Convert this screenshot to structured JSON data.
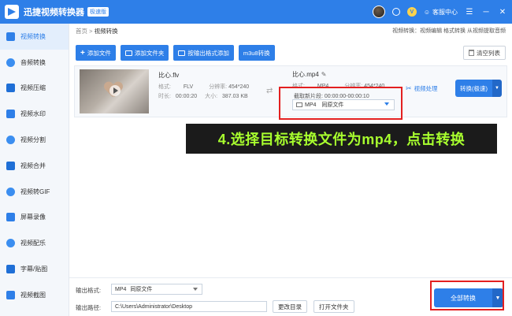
{
  "app": {
    "title": "迅捷视频转换器",
    "edition": "极速版",
    "service": "客服中心",
    "vip": "V"
  },
  "sidebar": {
    "items": [
      {
        "label": "视频转换",
        "active": true
      },
      {
        "label": "音频转换"
      },
      {
        "label": "视频压缩"
      },
      {
        "label": "视频水印"
      },
      {
        "label": "视频分割"
      },
      {
        "label": "视频合并"
      },
      {
        "label": "视频转GIF"
      },
      {
        "label": "屏幕录像"
      },
      {
        "label": "视频配乐"
      },
      {
        "label": "字幕/贴图"
      },
      {
        "label": "视频截图"
      }
    ]
  },
  "breadcrumb": {
    "home": "首页",
    "sep": ">",
    "current": "视频转换"
  },
  "top_links": "视频转换：视频编辑 格式转换 从视频提取音频",
  "toolbar": {
    "add_file": "添加文件",
    "add_folder": "添加文件夹",
    "add_by_format": "按输出格式添加",
    "m3u8": "m3u8转换",
    "clear": "清空列表"
  },
  "file": {
    "src_name": "比心.flv",
    "src_format_label": "格式:",
    "src_format": "FLV",
    "src_res_label": "分辨率:",
    "src_res": "454*240",
    "src_duration_label": "时长:",
    "src_duration": "00:00:20",
    "src_size_label": "大小:",
    "src_size": "387.03 KB",
    "dst_name": "比心.mp4",
    "dst_format_label": "格式:",
    "dst_format": "MP4",
    "dst_res_label": "分辨率:",
    "dst_res": "454*240",
    "clip_label": "截取新片段: 00:00:00-00:00:10",
    "select_format": "MP4",
    "select_quality": "同原文件",
    "video_process": "视频处理",
    "convert_btn": "转换(极速)"
  },
  "instruction": "4.选择目标转换文件为mp4，点击转换",
  "bottom": {
    "out_format_label": "输出格式:",
    "out_format": "MP4",
    "out_quality": "同原文件",
    "out_path_label": "输出路径:",
    "out_path": "C:\\Users\\Administrator\\Desktop",
    "change_dir": "更改目录",
    "open_folder": "打开文件夹",
    "convert_all": "全部转换"
  },
  "colors": {
    "accent": "#2e7fe8",
    "highlight_border": "#e32020",
    "instruction_text": "#a8ff2e"
  }
}
